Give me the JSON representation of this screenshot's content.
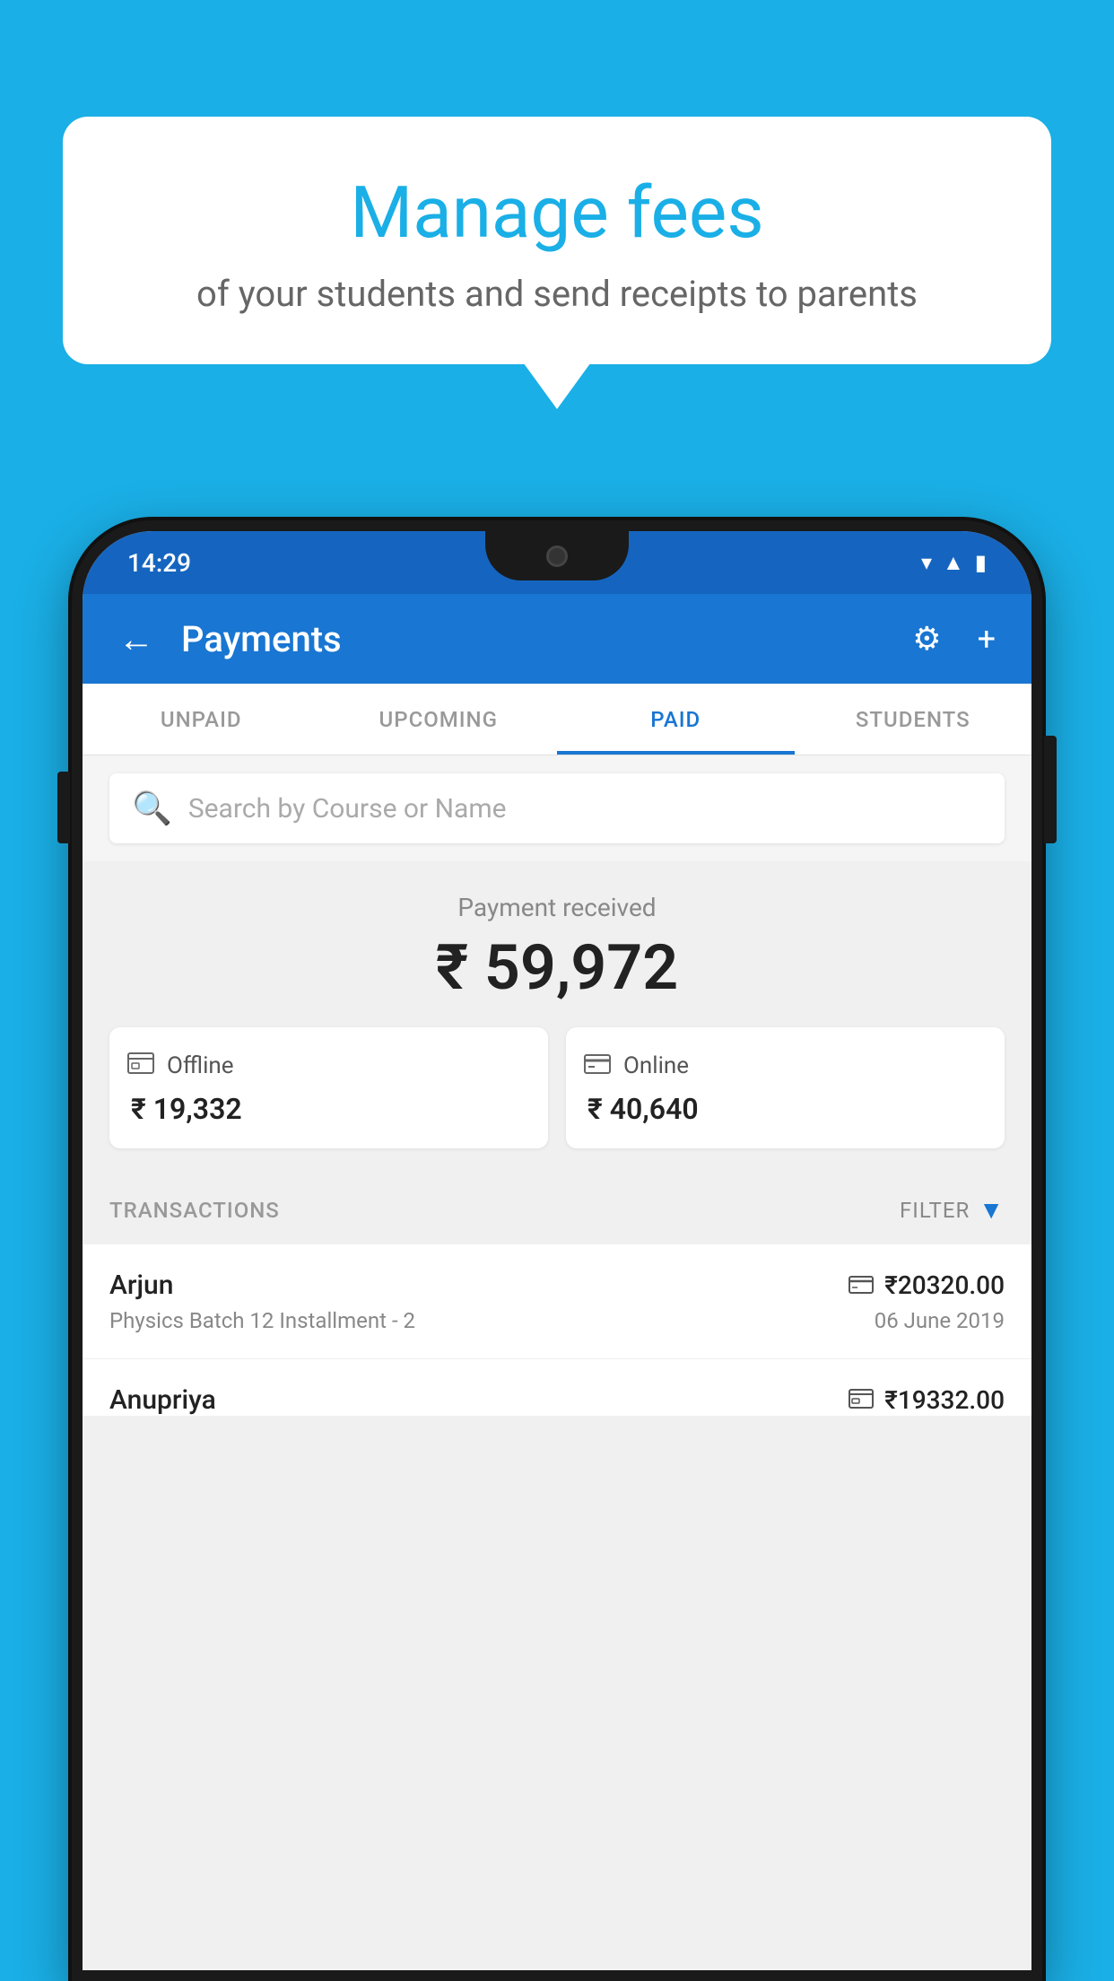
{
  "background_color": "#1AAFE6",
  "speech_bubble": {
    "title": "Manage fees",
    "subtitle": "of your students and send receipts to parents"
  },
  "status_bar": {
    "time": "14:29",
    "icons": [
      "wifi",
      "signal",
      "battery"
    ]
  },
  "app_bar": {
    "title": "Payments",
    "back_label": "←",
    "settings_label": "⚙",
    "add_label": "+"
  },
  "tabs": [
    {
      "label": "UNPAID",
      "active": false
    },
    {
      "label": "UPCOMING",
      "active": false
    },
    {
      "label": "PAID",
      "active": true
    },
    {
      "label": "STUDENTS",
      "active": false
    }
  ],
  "search": {
    "placeholder": "Search by Course or Name"
  },
  "payment_summary": {
    "label": "Payment received",
    "total": "₹ 59,972",
    "offline": {
      "label": "Offline",
      "amount": "₹ 19,332"
    },
    "online": {
      "label": "Online",
      "amount": "₹ 40,640"
    }
  },
  "transactions": {
    "label": "TRANSACTIONS",
    "filter_label": "FILTER",
    "items": [
      {
        "name": "Arjun",
        "amount": "₹20320.00",
        "course": "Physics Batch 12 Installment - 2",
        "date": "06 June 2019",
        "payment_type": "card"
      },
      {
        "name": "Anupriya",
        "amount": "₹19332.00",
        "course": "",
        "date": "",
        "payment_type": "offline"
      }
    ]
  }
}
